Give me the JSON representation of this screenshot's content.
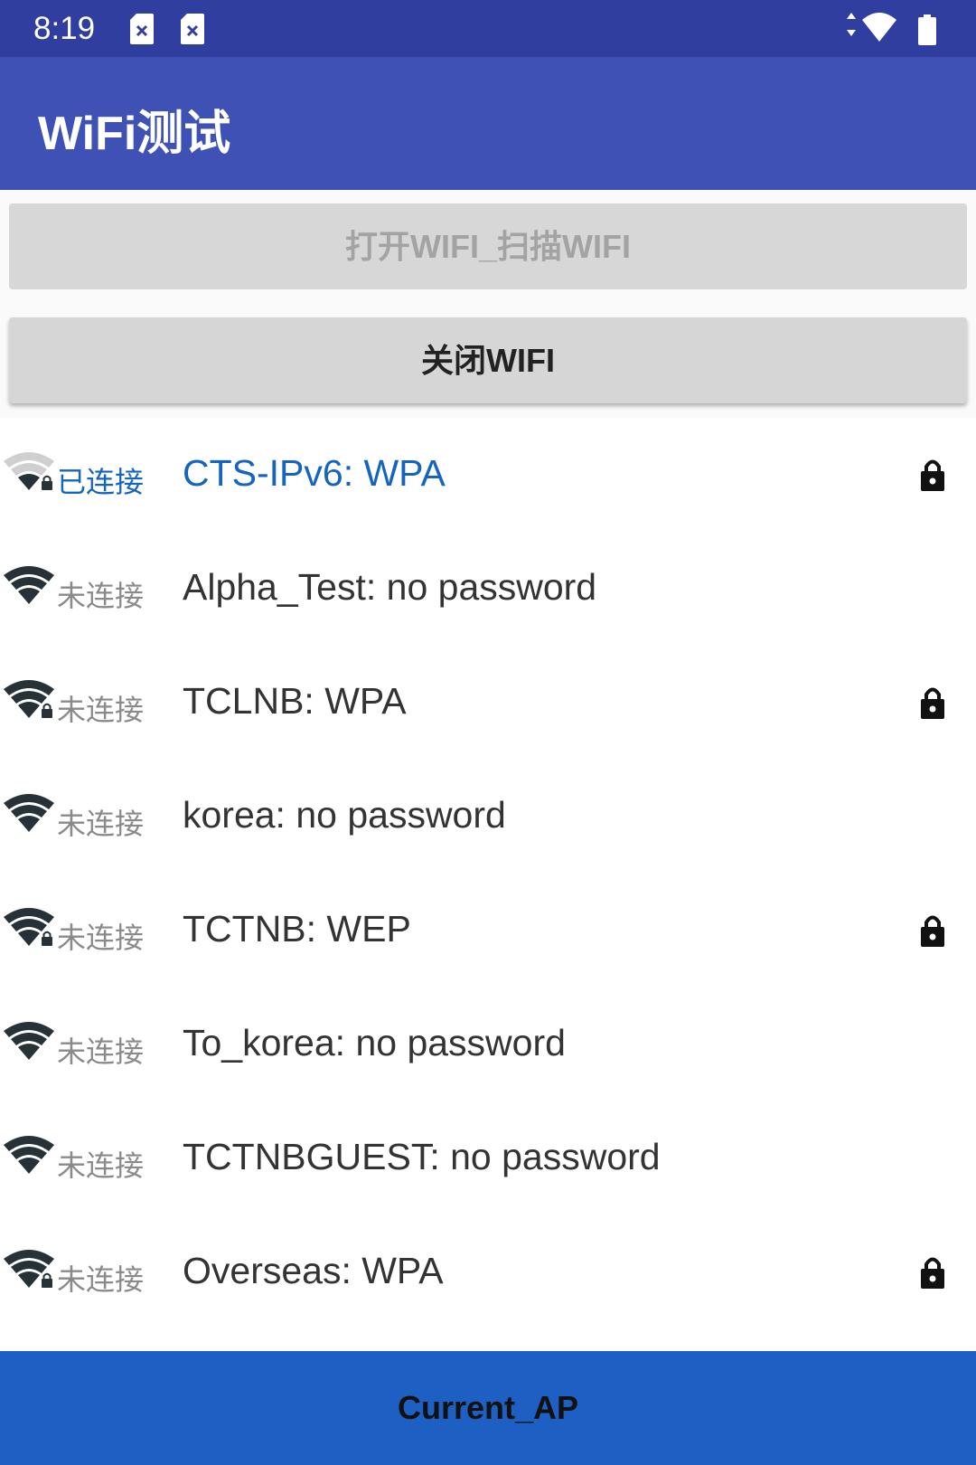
{
  "status_bar": {
    "time": "8:19",
    "icons": [
      "sim-card-icon",
      "sim-card-icon",
      "data-arrows-icon",
      "wifi-signal-icon",
      "battery-icon"
    ]
  },
  "app_bar": {
    "title": "WiFi测试"
  },
  "buttons": {
    "open_scan": "打开WIFI_扫描WIFI",
    "close_wifi": "关闭WIFI"
  },
  "wifi_list": [
    {
      "status": "已连接",
      "name": "CTS-IPv6: WPA",
      "secured": true,
      "connected": true
    },
    {
      "status": "未连接",
      "name": "Alpha_Test: no password",
      "secured": false,
      "connected": false
    },
    {
      "status": "未连接",
      "name": "TCLNB: WPA",
      "secured": true,
      "connected": false
    },
    {
      "status": "未连接",
      "name": "korea: no password",
      "secured": false,
      "connected": false
    },
    {
      "status": "未连接",
      "name": "TCTNB: WEP",
      "secured": true,
      "connected": false
    },
    {
      "status": "未连接",
      "name": "To_korea: no password",
      "secured": false,
      "connected": false
    },
    {
      "status": "未连接",
      "name": "TCTNBGUEST: no password",
      "secured": false,
      "connected": false
    },
    {
      "status": "未连接",
      "name": "Overseas: WPA",
      "secured": true,
      "connected": false
    }
  ],
  "bottom_button": {
    "label": "Current_AP"
  },
  "colors": {
    "status_bar": "#303F9F",
    "app_bar": "#3F51B5",
    "connected_text": "#1565C0",
    "bottom_button": "#1E5FC3"
  }
}
